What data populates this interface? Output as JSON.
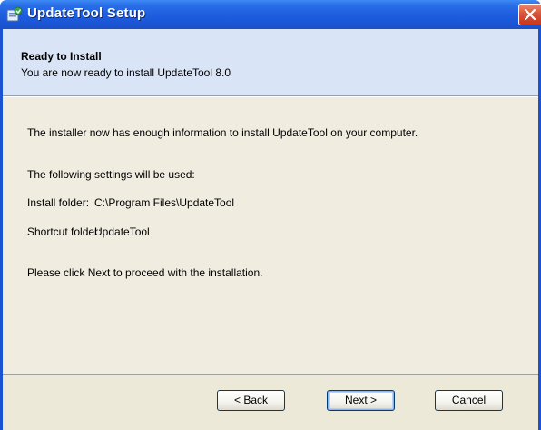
{
  "window": {
    "title": "UpdateTool Setup"
  },
  "header": {
    "title": "Ready to Install",
    "subtitle": "You are now ready to install UpdateTool 8.0"
  },
  "body": {
    "intro": "The installer now has enough information to install UpdateTool on your computer.",
    "settings_heading": "The following settings will be used:",
    "install_folder_label": "Install folder:",
    "install_folder_value": "C:\\Program Files\\UpdateTool",
    "shortcut_folder_label": "Shortcut folder:",
    "shortcut_folder_value": "UpdateTool",
    "instruction": "Please click Next to proceed with the installation."
  },
  "buttons": {
    "back": {
      "prefix": "< ",
      "accel": "B",
      "rest": "ack"
    },
    "next": {
      "accel": "N",
      "rest": "ext >"
    },
    "cancel": {
      "accel": "C",
      "rest": "ancel"
    }
  },
  "icons": [
    "app-installer-icon",
    "close-icon"
  ],
  "colors": {
    "title_bar": "#1d5ee0",
    "header_bg": "#d9e5f6",
    "body_bg": "#f0ede0",
    "close_red": "#d8553a"
  }
}
